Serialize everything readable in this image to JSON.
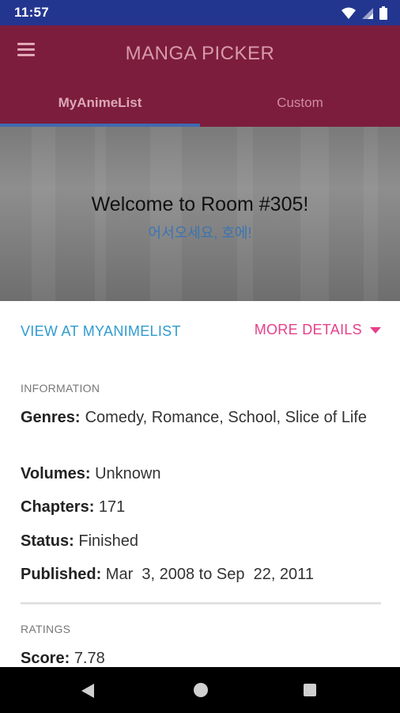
{
  "status_bar": {
    "time": "11:57"
  },
  "app_bar": {
    "title": "MANGA PICKER"
  },
  "tabs": [
    {
      "label": "MyAnimeList",
      "active": true
    },
    {
      "label": "Custom",
      "active": false
    }
  ],
  "banner": {
    "title": "Welcome to Room #305!",
    "subtitle": "어서오세요, 호에!"
  },
  "actions": {
    "view_label": "VIEW AT MYANIMELIST",
    "more_label": "MORE DETAILS"
  },
  "information": {
    "section_label": "INFORMATION",
    "genres_key": "Genres:",
    "genres_value": "Comedy, Romance, School, Slice of Life",
    "volumes_key": "Volumes:",
    "volumes_value": "Unknown",
    "chapters_key": "Chapters:",
    "chapters_value": "171",
    "status_key": "Status:",
    "status_value": "Finished",
    "published_key": "Published:",
    "published_value": "Mar  3, 2008 to Sep  22, 2011"
  },
  "ratings": {
    "section_label": "RATINGS",
    "score_key": "Score:",
    "score_value": "7.78"
  },
  "colors": {
    "status_bar": "#23368f",
    "app_bar": "#7d1d3d",
    "tab_indicator": "#3f6bb0",
    "link_blue": "#2f9bd0",
    "accent_pink": "#e5408a"
  }
}
